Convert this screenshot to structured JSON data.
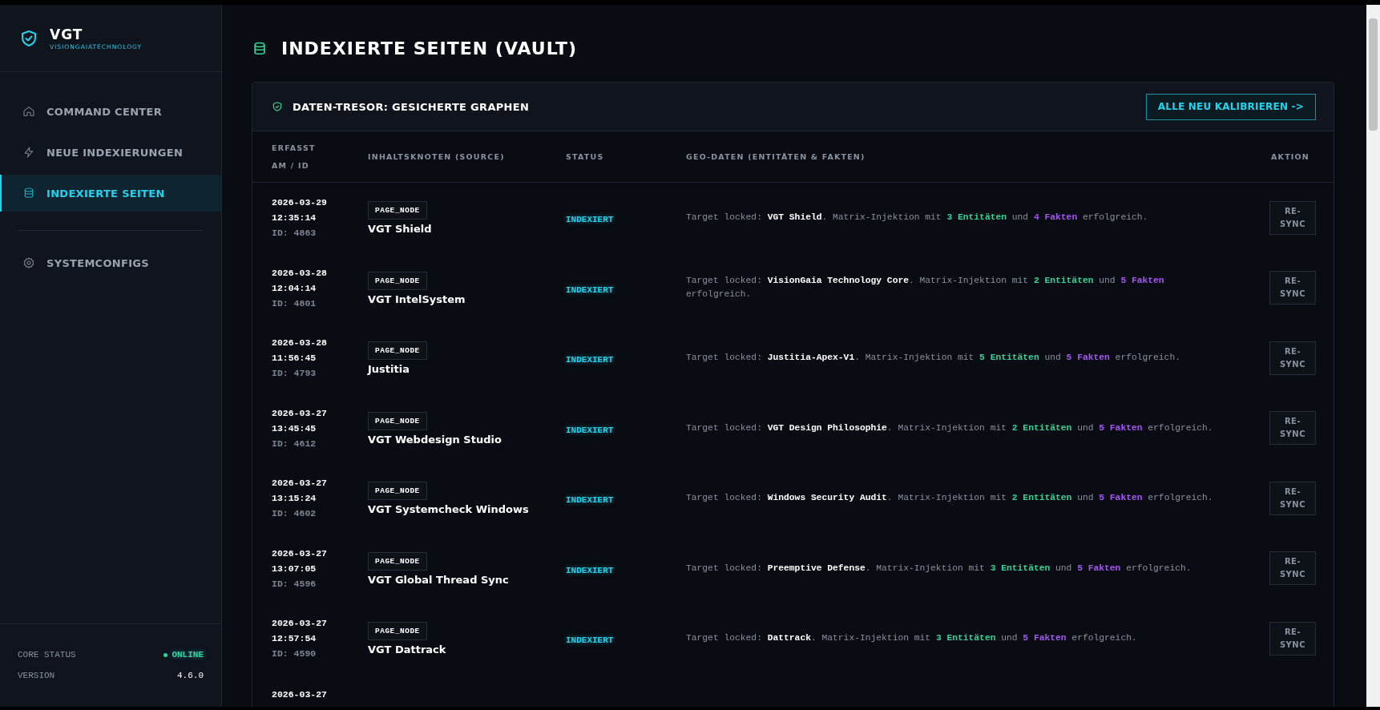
{
  "sidebar": {
    "logo": {
      "title": "VGT",
      "subtitle": "VISIONGAIATECHNOLOGY"
    },
    "items": [
      {
        "label": "COMMAND CENTER",
        "kind": "home",
        "selected": false
      },
      {
        "label": "NEUE INDEXIERUNGEN",
        "kind": "bolt",
        "selected": false
      },
      {
        "label": "INDEXIERTE SEITEN",
        "kind": "database",
        "selected": true
      }
    ],
    "items_bottom": [
      {
        "label": "SYSTEMCONFIGS",
        "kind": "gear",
        "selected": false
      }
    ],
    "footer": [
      {
        "label": "CORE STATUS",
        "value": "ONLINE",
        "kind": "status"
      },
      {
        "label": "VERSION",
        "value": "4.6.0",
        "kind": "plain"
      }
    ]
  },
  "page_title": "INDEXIERTE SEITEN (VAULT)",
  "card": {
    "title": "DATEN-TRESOR: GESICHERTE GRAPHEN",
    "action": "ALLE NEU KALIBRIEREN ->",
    "columns": [
      "ERFASST AM / ID",
      "INHALTSKNOTEN (SOURCE)",
      "STATUS",
      "GEO-DATEN (ENTITÄTEN & FAKTEN)",
      "AKTION"
    ],
    "rows": [
      {
        "date": "2026-03-29",
        "time": "12:35:14",
        "id": "ID: 4863",
        "badge": "PAGE_NODE",
        "name": "VGT Shield",
        "status": "INDEXIERT",
        "geo": [
          {
            "kind": "plain",
            "text": "Target locked: "
          },
          {
            "kind": "target",
            "text": "VGT Shield"
          },
          {
            "kind": "plain",
            "text": ". Matrix-Injektion mit "
          },
          {
            "kind": "entities",
            "text": "3 Entitäten"
          },
          {
            "kind": "plain",
            "text": " und "
          },
          {
            "kind": "facts",
            "text": "4 Fakten"
          },
          {
            "kind": "plain",
            "text": " erfolgreich."
          }
        ],
        "button": "RE-SYNC"
      },
      {
        "date": "2026-03-28",
        "time": "12:04:14",
        "id": "ID: 4801",
        "badge": "PAGE_NODE",
        "name": "VGT IntelSystem",
        "status": "INDEXIERT",
        "geo": [
          {
            "kind": "plain",
            "text": "Target locked: "
          },
          {
            "kind": "target",
            "text": "VisionGaia Technology Core"
          },
          {
            "kind": "plain",
            "text": ". Matrix-Injektion mit "
          },
          {
            "kind": "entities",
            "text": "2 Entitäten"
          },
          {
            "kind": "plain",
            "text": " und "
          },
          {
            "kind": "facts",
            "text": "5 Fakten"
          },
          {
            "kind": "plain",
            "text": " erfolgreich."
          }
        ],
        "button": "RE-SYNC"
      },
      {
        "date": "2026-03-28",
        "time": "11:56:45",
        "id": "ID: 4793",
        "badge": "PAGE_NODE",
        "name": "Justitia",
        "status": "INDEXIERT",
        "geo": [
          {
            "kind": "plain",
            "text": "Target locked: "
          },
          {
            "kind": "target",
            "text": "Justitia-Apex-V1"
          },
          {
            "kind": "plain",
            "text": ". Matrix-Injektion mit "
          },
          {
            "kind": "entities",
            "text": "5 Entitäten"
          },
          {
            "kind": "plain",
            "text": " und "
          },
          {
            "kind": "facts",
            "text": "5 Fakten"
          },
          {
            "kind": "plain",
            "text": " erfolgreich."
          }
        ],
        "button": "RE-SYNC"
      },
      {
        "date": "2026-03-27",
        "time": "13:45:45",
        "id": "ID: 4612",
        "badge": "PAGE_NODE",
        "name": "VGT Webdesign Studio",
        "status": "INDEXIERT",
        "geo": [
          {
            "kind": "plain",
            "text": "Target locked: "
          },
          {
            "kind": "target",
            "text": "VGT Design Philosophie"
          },
          {
            "kind": "plain",
            "text": ". Matrix-Injektion mit "
          },
          {
            "kind": "entities",
            "text": "2 Entitäten"
          },
          {
            "kind": "plain",
            "text": " und "
          },
          {
            "kind": "facts",
            "text": "5 Fakten"
          },
          {
            "kind": "plain",
            "text": " erfolgreich."
          }
        ],
        "button": "RE-SYNC"
      },
      {
        "date": "2026-03-27",
        "time": "13:15:24",
        "id": "ID: 4602",
        "badge": "PAGE_NODE",
        "name": "VGT Systemcheck Windows",
        "status": "INDEXIERT",
        "geo": [
          {
            "kind": "plain",
            "text": "Target locked: "
          },
          {
            "kind": "target",
            "text": "Windows Security Audit"
          },
          {
            "kind": "plain",
            "text": ". Matrix-Injektion mit "
          },
          {
            "kind": "entities",
            "text": "2 Entitäten"
          },
          {
            "kind": "plain",
            "text": " und "
          },
          {
            "kind": "facts",
            "text": "5 Fakten"
          },
          {
            "kind": "plain",
            "text": " erfolgreich."
          }
        ],
        "button": "RE-SYNC"
      },
      {
        "date": "2026-03-27",
        "time": "13:07:05",
        "id": "ID: 4596",
        "badge": "PAGE_NODE",
        "name": "VGT Global Thread Sync",
        "status": "INDEXIERT",
        "geo": [
          {
            "kind": "plain",
            "text": "Target locked: "
          },
          {
            "kind": "target",
            "text": "Preemptive Defense"
          },
          {
            "kind": "plain",
            "text": ". Matrix-Injektion mit "
          },
          {
            "kind": "entities",
            "text": "3 Entitäten"
          },
          {
            "kind": "plain",
            "text": " und "
          },
          {
            "kind": "facts",
            "text": "5 Fakten"
          },
          {
            "kind": "plain",
            "text": " erfolgreich."
          }
        ],
        "button": "RE-SYNC"
      },
      {
        "date": "2026-03-27",
        "time": "12:57:54",
        "id": "ID: 4590",
        "badge": "PAGE_NODE",
        "name": "VGT Dattrack",
        "status": "INDEXIERT",
        "geo": [
          {
            "kind": "plain",
            "text": "Target locked: "
          },
          {
            "kind": "target",
            "text": "Dattrack"
          },
          {
            "kind": "plain",
            "text": ". Matrix-Injektion mit "
          },
          {
            "kind": "entities",
            "text": "3 Entitäten"
          },
          {
            "kind": "plain",
            "text": " und "
          },
          {
            "kind": "facts",
            "text": "5 Fakten"
          },
          {
            "kind": "plain",
            "text": " erfolgreich."
          }
        ],
        "button": "RE-SYNC"
      },
      {
        "date": "2026-03-27"
      }
    ]
  }
}
